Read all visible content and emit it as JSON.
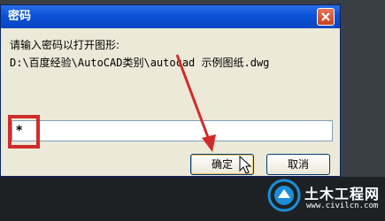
{
  "dialog": {
    "title": "密码",
    "prompt": "请输入密码以打开图形:",
    "file_path": "D:\\百度经验\\AutoCAD类别\\autocad 示例图纸.dwg",
    "password_value": "*",
    "ok_label": "确定",
    "cancel_label": "取消"
  },
  "watermark": {
    "name": "土木工程网",
    "url": "www.civilcn.com"
  },
  "colors": {
    "titlebar": "#0a51d6",
    "annotation": "#d12c2c",
    "dialog_bg": "#ece9d8"
  }
}
